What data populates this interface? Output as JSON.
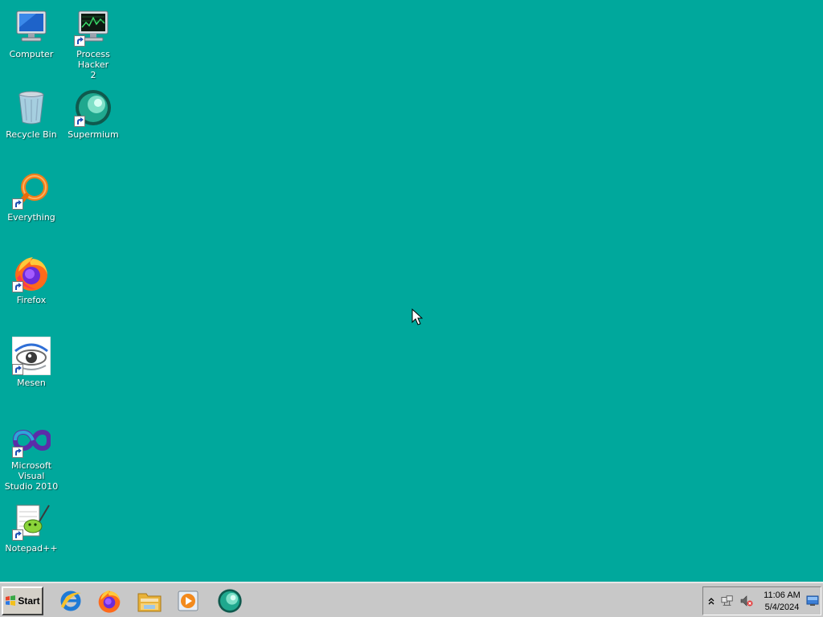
{
  "desktop": {
    "background_color": "#00a89c",
    "icons": {
      "computer": {
        "label": "Computer",
        "icon": "computer-icon"
      },
      "process_hacker": {
        "label": "Process Hacker\n2",
        "icon": "process-hacker-icon"
      },
      "recycle_bin": {
        "label": "Recycle Bin",
        "icon": "recycle-bin-icon"
      },
      "supermium": {
        "label": "Supermium",
        "icon": "supermium-icon"
      },
      "everything": {
        "label": "Everything",
        "icon": "everything-icon"
      },
      "firefox": {
        "label": "Firefox",
        "icon": "firefox-icon"
      },
      "mesen": {
        "label": "Mesen",
        "icon": "mesen-icon"
      },
      "visual_studio": {
        "label": "Microsoft Visual\nStudio 2010",
        "icon": "visual-studio-icon"
      },
      "notepadpp": {
        "label": "Notepad++",
        "icon": "notepadpp-icon"
      }
    }
  },
  "taskbar": {
    "start_label": "Start",
    "pinned": [
      "internet-explorer-icon",
      "firefox-icon",
      "file-explorer-icon",
      "media-player-icon",
      "supermium-icon"
    ],
    "tray": {
      "icons": [
        "show-hidden-icons-chevron",
        "network-icon",
        "volume-muted-icon"
      ],
      "time": "11:06 AM",
      "date": "5/4/2024"
    }
  }
}
